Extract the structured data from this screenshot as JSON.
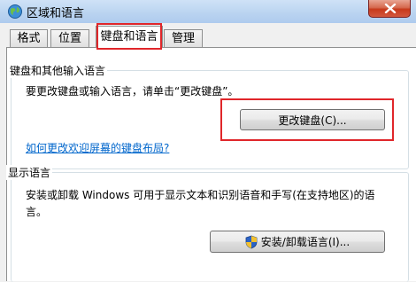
{
  "window": {
    "title": "区域和语言",
    "icon": "globe-icon",
    "close_icon": "close-icon"
  },
  "tabs": [
    {
      "label": "格式",
      "selected": false
    },
    {
      "label": "位置",
      "selected": false
    },
    {
      "label": "键盘和语言",
      "selected": true
    },
    {
      "label": "管理",
      "selected": false
    }
  ],
  "keyboard_group": {
    "title": "键盘和其他输入语言",
    "description": "要更改键盘或输入语言，请单击“更改键盘”。",
    "change_button": "更改键盘(C)...",
    "help_link": "如何更改欢迎屏幕的键盘布局?"
  },
  "display_group": {
    "title": "显示语言",
    "description_line1": "安装或卸载 Windows 可用于显示文本和识别语音和手写(在支持地区)的语",
    "description_line2": "言。",
    "install_button": "安装/卸载语言(I)...",
    "install_button_icon": "uac-shield-icon"
  },
  "colors": {
    "highlight": "#e0262a",
    "link": "#0066cc"
  }
}
